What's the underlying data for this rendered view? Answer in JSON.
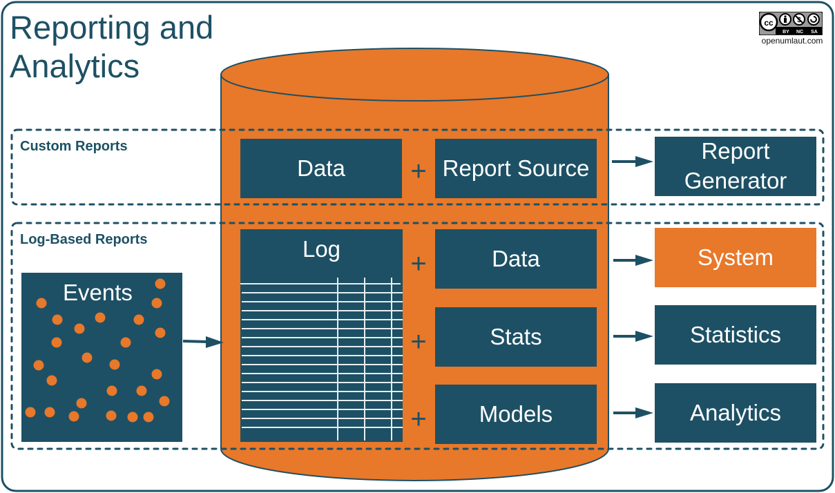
{
  "title": "Reporting and\nAnalytics",
  "license": {
    "badge_labels": [
      "BY",
      "NC",
      "SA"
    ],
    "icons": [
      "cc-icon",
      "attribution-icon",
      "noncommercial-icon",
      "sharealike-icon"
    ],
    "site": "openumlaut.com"
  },
  "colors": {
    "teal": "#1d5064",
    "orange": "#e8782a",
    "white": "#ffffff"
  },
  "sections": {
    "custom_reports": {
      "label": "Custom Reports",
      "inputs": [
        "Data",
        "Report Source"
      ],
      "operator": "+",
      "output": "Report\nGenerator"
    },
    "log_based_reports": {
      "label": "Log-Based Reports",
      "source": "Events",
      "log": "Log",
      "rows": [
        {
          "operator": "+",
          "input": "Data",
          "output": "System",
          "output_highlight": true
        },
        {
          "operator": "+",
          "input": "Stats",
          "output": "Statistics",
          "output_highlight": false
        },
        {
          "operator": "+",
          "input": "Models",
          "output": "Analytics",
          "output_highlight": false
        }
      ]
    }
  }
}
